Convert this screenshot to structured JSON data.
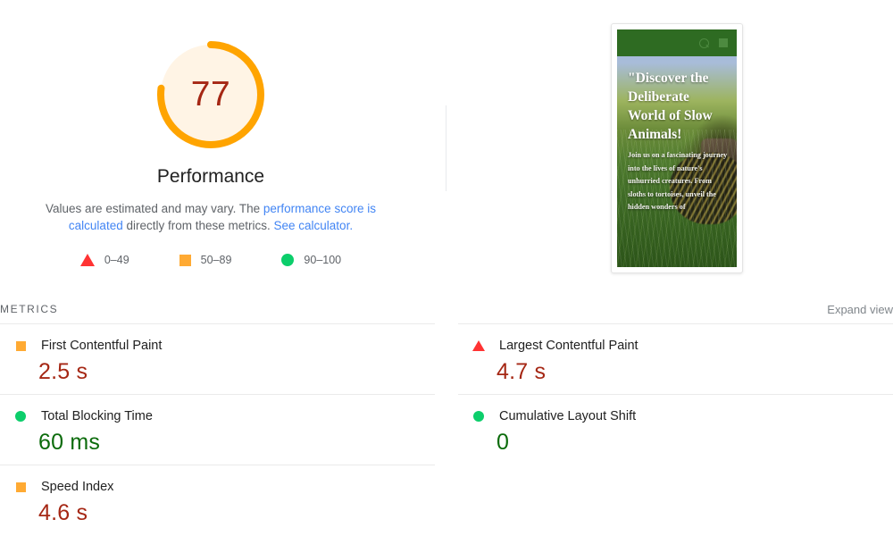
{
  "gauge": {
    "score": "77",
    "title": "Performance",
    "score_color": "#a52714",
    "arc_color": "#ffa400",
    "track_color": "#fff4e5",
    "percent": 77,
    "description_part1": "Values are estimated and may vary. The ",
    "description_link1": "performance score is calculated",
    "description_part2": " directly from these metrics. ",
    "description_link2": "See calculator.",
    "link_color": "#4285f4"
  },
  "legend": {
    "items": [
      {
        "icon": "fail-triangle-icon",
        "label": "0–49",
        "color": "#ff3333"
      },
      {
        "icon": "average-square-icon",
        "label": "50–89",
        "color": "#ffaa33"
      },
      {
        "icon": "pass-circle-icon",
        "label": "90–100",
        "color": "#0cce6b"
      }
    ]
  },
  "thumbnail": {
    "header": {
      "background": "#2e6b22",
      "search_icon": "search-icon",
      "menu_icon": "hamburger-menu-icon"
    },
    "headline": "\"Discover the Deliberate World of Slow Animals!",
    "body": "Join us on a fascinating journey into the lives of nature's unhurried creatures. From sloths to tortoises, unveil the hidden wonders of"
  },
  "metrics": {
    "section_title": "METRICS",
    "expand_label": "Expand view",
    "left_column": [
      {
        "name": "First Contentful Paint",
        "value": "2.5 s",
        "rating": "average",
        "icon": "average-square-icon",
        "icon_color": "#ffaa33",
        "value_color": "#a52714"
      },
      {
        "name": "Total Blocking Time",
        "value": "60 ms",
        "rating": "pass",
        "icon": "pass-circle-icon",
        "icon_color": "#0cce6b",
        "value_color": "#0b6b0b"
      },
      {
        "name": "Speed Index",
        "value": "4.6 s",
        "rating": "average",
        "icon": "average-square-icon",
        "icon_color": "#ffaa33",
        "value_color": "#a52714"
      }
    ],
    "right_column": [
      {
        "name": "Largest Contentful Paint",
        "value": "4.7 s",
        "rating": "fail",
        "icon": "fail-triangle-icon",
        "icon_color": "#ff3333",
        "value_color": "#a52714"
      },
      {
        "name": "Cumulative Layout Shift",
        "value": "0",
        "rating": "pass",
        "icon": "pass-circle-icon",
        "icon_color": "#0cce6b",
        "value_color": "#0b6b0b"
      }
    ]
  }
}
